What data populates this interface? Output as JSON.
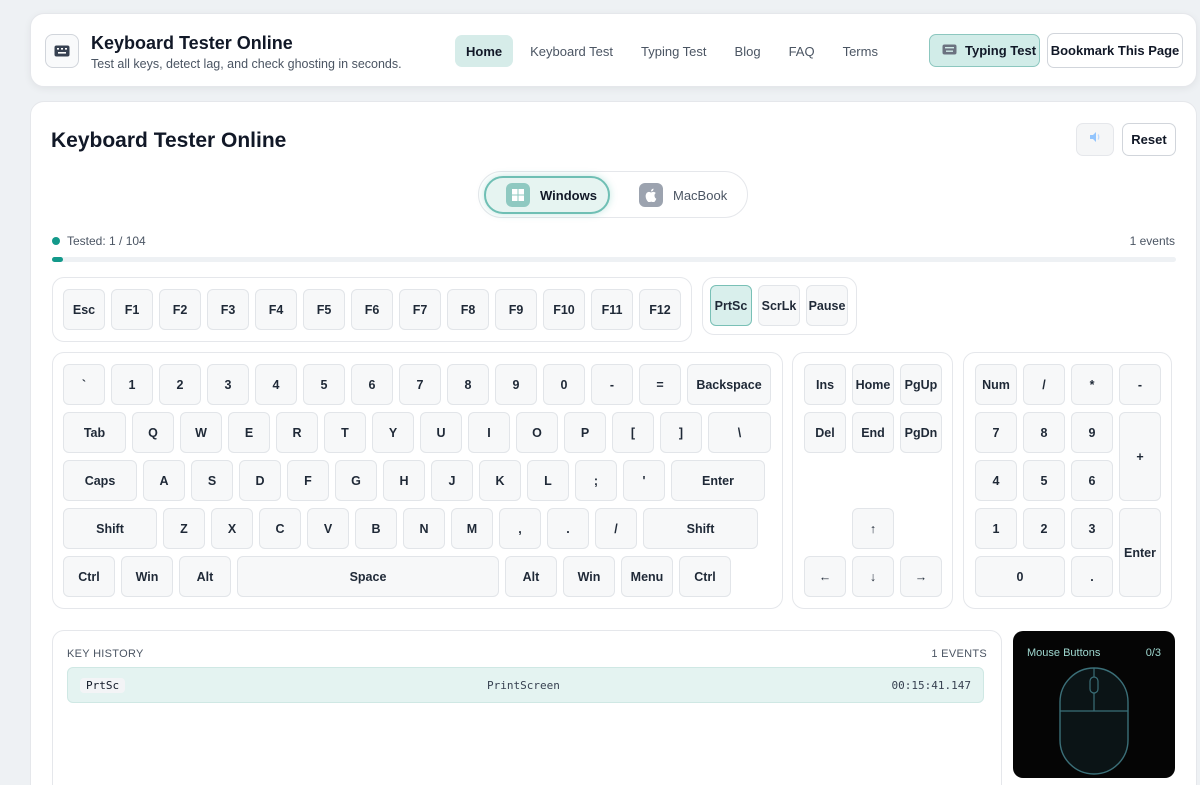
{
  "header": {
    "title": "Keyboard Tester Online",
    "subtitle": "Test all keys, detect lag, and check ghosting in seconds.",
    "logo_icon": "keyboard-icon",
    "nav": [
      "Home",
      "Keyboard Test",
      "Typing Test",
      "Blog",
      "FAQ",
      "Terms"
    ],
    "active_nav": "Home",
    "typing_button": "Typing Test",
    "bookmark_button": "Bookmark This Page"
  },
  "main": {
    "title": "Keyboard Tester Online",
    "sound_icon": "speaker-icon",
    "reset_label": "Reset",
    "os": {
      "windows": "Windows",
      "mac": "MacBook",
      "selected": "Windows"
    },
    "tested_label": "Tested: 1 / 104",
    "events_label": "1 events",
    "progress_fraction": 0.0096
  },
  "keyboard": {
    "function_row": [
      "Esc",
      "F1",
      "F2",
      "F3",
      "F4",
      "F5",
      "F6",
      "F7",
      "F8",
      "F9",
      "F10",
      "F11",
      "F12"
    ],
    "system_keys": [
      "PrtSc",
      "ScrLk",
      "Pause"
    ],
    "row_number": [
      "`",
      "1",
      "2",
      "3",
      "4",
      "5",
      "6",
      "7",
      "8",
      "9",
      "0",
      "-",
      "=",
      "Backspace"
    ],
    "row_qwerty": [
      "Tab",
      "Q",
      "W",
      "E",
      "R",
      "T",
      "Y",
      "U",
      "I",
      "O",
      "P",
      "[",
      "]",
      "\\"
    ],
    "row_home": [
      "Caps",
      "A",
      "S",
      "D",
      "F",
      "G",
      "H",
      "J",
      "K",
      "L",
      ";",
      "'",
      "Enter"
    ],
    "row_shift": [
      "Shift",
      "Z",
      "X",
      "C",
      "V",
      "B",
      "N",
      "M",
      ",",
      ".",
      "/",
      "Shift"
    ],
    "row_bottom": [
      "Ctrl",
      "Win",
      "Alt",
      "Space",
      "Alt",
      "Win",
      "Menu",
      "Ctrl"
    ],
    "nav_cluster": [
      "Ins",
      "Home",
      "PgUp",
      "Del",
      "End",
      "PgDn"
    ],
    "arrows": [
      "↑",
      "←",
      "↓",
      "→"
    ],
    "numpad": [
      "Num",
      "/",
      "*",
      "-",
      "7",
      "8",
      "9",
      "+",
      "4",
      "5",
      "6",
      "1",
      "2",
      "3",
      "Enter",
      "0",
      "."
    ],
    "pressed": [
      "PrtSc"
    ]
  },
  "history": {
    "label": "KEY HISTORY",
    "count_label": "1 EVENTS",
    "rows": [
      {
        "key": "PrtSc",
        "code": "PrintScreen",
        "time": "00:15:41.147"
      }
    ]
  },
  "mouse": {
    "label": "Mouse Buttons",
    "count": "0/3",
    "icon": "mouse-icon"
  }
}
